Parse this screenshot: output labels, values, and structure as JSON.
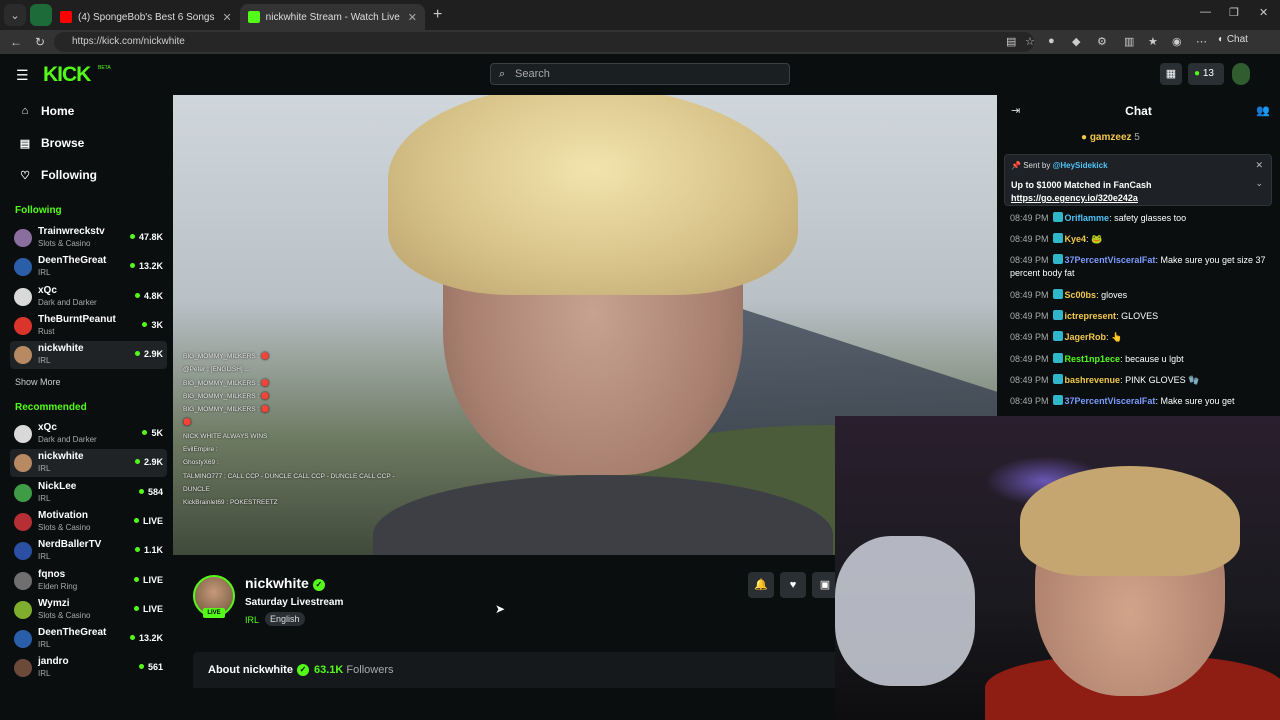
{
  "browser": {
    "tabs": [
      {
        "title": "(4) SpongeBob's Best 6 Songs",
        "color": "#ff0000"
      },
      {
        "title": "nickwhite Stream - Watch Live",
        "color": "#53fc18"
      }
    ],
    "url": "https://kick.com/nickwhite",
    "chat_button": "Chat"
  },
  "header": {
    "logo": "KICK",
    "beta": "BETA",
    "search_placeholder": "Search",
    "points": "13"
  },
  "sidebar": {
    "nav": [
      {
        "label": "Home",
        "icon": "home-icon"
      },
      {
        "label": "Browse",
        "icon": "browse-icon"
      },
      {
        "label": "Following",
        "icon": "heart-icon"
      }
    ],
    "following_heading": "Following",
    "following": [
      {
        "name": "Trainwreckstv",
        "category": "Slots & Casino",
        "count": "47.8K",
        "color": "#8a6f9e"
      },
      {
        "name": "DeenTheGreat",
        "category": "IRL",
        "count": "13.2K",
        "color": "#2b5ea8"
      },
      {
        "name": "xQc",
        "category": "Dark and Darker",
        "count": "4.8K",
        "color": "#d9d9d9"
      },
      {
        "name": "TheBurntPeanut",
        "category": "Rust",
        "count": "3K",
        "color": "#d9352b"
      },
      {
        "name": "nickwhite",
        "category": "IRL",
        "count": "2.9K",
        "color": "#b88a63"
      }
    ],
    "show_more": "Show More",
    "recommended_heading": "Recommended",
    "recommended": [
      {
        "name": "xQc",
        "category": "Dark and Darker",
        "count": "5K",
        "color": "#d9d9d9"
      },
      {
        "name": "nickwhite",
        "category": "IRL",
        "count": "2.9K",
        "color": "#b88a63"
      },
      {
        "name": "NickLee",
        "category": "IRL",
        "count": "584",
        "color": "#3f9b46"
      },
      {
        "name": "Motivation",
        "category": "Slots & Casino",
        "count": "LIVE",
        "color": "#b52f35"
      },
      {
        "name": "NerdBallerTV",
        "category": "IRL",
        "count": "1.1K",
        "color": "#2a4fa3"
      },
      {
        "name": "fqnos",
        "category": "Elden Ring",
        "count": "LIVE",
        "color": "#6f6f6f"
      },
      {
        "name": "Wymzi",
        "category": "Slots & Casino",
        "count": "LIVE",
        "color": "#7fae2e"
      },
      {
        "name": "DeenTheGreat",
        "category": "IRL",
        "count": "13.2K",
        "color": "#2b5ea8"
      },
      {
        "name": "jandro",
        "category": "IRL",
        "count": "561",
        "color": "#6b4a3a"
      }
    ]
  },
  "video_overlay_chat": [
    "BIG_MOMMY_MILKERS : 🛑",
    "@Peter : [ENGLISH] ...",
    "BIG_MOMMY_MILKERS : 🛑",
    "BIG_MOMMY_MILKERS : 🛑",
    "BIG_MOMMY_MILKERS : 🛑",
    "🛑",
    "NICK WHITE ALWAYS WINS",
    "EvilEmpire :",
    "GhostyX69 :",
    "TALMINO777 : CALL CCP - DUNCLE   CALL CCP - DUNCLE   CALL CCP -",
    "DUNCLE",
    "KickBrainlet69 : POKESTREETZ"
  ],
  "stream": {
    "name": "nickwhite",
    "live_label": "LIVE",
    "title": "Saturday Livestream",
    "category": "IRL",
    "language": "English",
    "about_label": "About nickwhite",
    "followers_count": "63.1K",
    "followers_label": "Followers"
  },
  "chat": {
    "title": "Chat",
    "gifter": {
      "name": "gamzeez",
      "count": "5"
    },
    "pinned": {
      "sent_by_prefix": "Sent by",
      "sent_by_user": "@HeySidekick",
      "title": "Up to $1000 Matched in FanCash",
      "link": "https://go.egency.io/320e242a"
    },
    "messages": [
      {
        "time": "08:49 PM",
        "user": "Oriflamme",
        "color": "#4fc3f7",
        "text": "safety glasses too"
      },
      {
        "time": "08:49 PM",
        "user": "Kye4",
        "color": "#f2c94c",
        "text": "🐸"
      },
      {
        "time": "08:49 PM",
        "user": "37PercentVisceralFat",
        "color": "#7b9cff",
        "text": "Make sure you get size 37 percent body fat"
      },
      {
        "time": "08:49 PM",
        "user": "Sc00bs",
        "color": "#f2c94c",
        "text": "gloves"
      },
      {
        "time": "08:49 PM",
        "user": "ictrepresent",
        "color": "#f2c94c",
        "text": "GLOVES"
      },
      {
        "time": "08:49 PM",
        "user": "JagerRob",
        "color": "#f2c94c",
        "text": "👆"
      },
      {
        "time": "08:49 PM",
        "user": "Rest1np1ece",
        "color": "#53fc18",
        "text": "because u lgbt"
      },
      {
        "time": "08:49 PM",
        "user": "bashrevenue",
        "color": "#f2c94c",
        "text": "PINK GLOVES 🧤"
      },
      {
        "time": "08:49 PM",
        "user": "37PercentVisceralFat",
        "color": "#7b9cff",
        "text": "Make sure you get"
      }
    ]
  },
  "colors": {
    "accent": "#53fc18",
    "bg": "#0b0e0f"
  }
}
